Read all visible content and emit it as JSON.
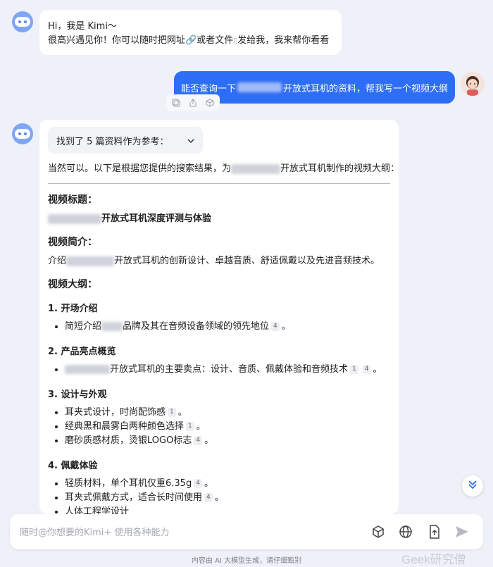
{
  "greeting": {
    "line1": "Hi，我是 Kimi～",
    "line2a": "很高兴遇见你！你可以随时把网址",
    "line2b": "或者文件",
    "line2c": "发给我，我来帮你看看"
  },
  "user_message": {
    "part1": "能否查询一下",
    "part2": "开放式耳机的资料，帮我写一个视频大纲"
  },
  "answer": {
    "refs_label": "找到了 5 篇资料作为参考：",
    "intro_a": "当然可以。以下是根据您提供的搜索结果，为",
    "intro_b": "开放式耳机制作的视频大纲：",
    "title_heading": "视频标题：",
    "title_text": "开放式耳机深度评测与体验",
    "summary_heading": "视频简介：",
    "summary_a": "介绍",
    "summary_b": "开放式耳机的创新设计、卓越音质、舒适佩戴以及先进音频技术。",
    "outline_heading": "视频大纲：",
    "s1_title": "1. 开场介绍",
    "s1_i1a": "简短介绍",
    "s1_i1b": "品牌及其在音频设备领域的领先地位",
    "s2_title": "2. 产品亮点概览",
    "s2_i1": "开放式耳机的主要卖点：设计、音质、佩戴体验和音频技术",
    "s3_title": "3. 设计与外观",
    "s3_i1": "耳夹式设计，时尚配饰感",
    "s3_i2": "经典黑和晨雾白两种颜色选择",
    "s3_i3": "磨砂质感材质，烫银LOGO标志",
    "s4_title": "4. 佩戴体验",
    "s4_i1": "轻质材料，单个耳机仅重6.35g",
    "s4_i2": "耳夹式佩戴方式，适合长时间使用",
    "s4_i3": "人体工程学设计"
  },
  "cites": {
    "c1": "1",
    "c4": "4"
  },
  "input": {
    "placeholder": "随时@你想要的Kimi+ 使用各种能力"
  },
  "footer": "内容由 AI 大模型生成，请仔细甄别",
  "watermark": "Geek研究僧",
  "colors": {
    "accent": "#2e6df6",
    "background": "#eef1f8"
  }
}
